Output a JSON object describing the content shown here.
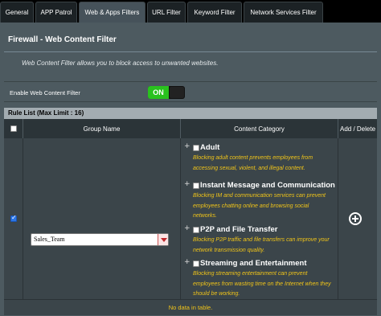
{
  "tabs": [
    {
      "label": "General",
      "active": false
    },
    {
      "label": "APP Patrol",
      "active": false
    },
    {
      "label": "Web & Apps Filters",
      "active": true
    },
    {
      "label": "URL Filter",
      "active": false
    },
    {
      "label": "Keyword Filter",
      "active": false
    },
    {
      "label": "Network Services Filter",
      "active": false
    }
  ],
  "page": {
    "title": "Firewall - Web Content Filter",
    "description": "Web Content Filter allows you to block access to unwanted websites."
  },
  "enable": {
    "label": "Enable Web Content Filter",
    "state": "ON"
  },
  "rule_list": {
    "title": "Rule List (Max Limit : 16)",
    "headers": {
      "group_name": "Group Name",
      "content_category": "Content Category",
      "add_delete": "Add / Delete"
    },
    "row_checked": true,
    "group_select_value": "Sales_Team",
    "categories": [
      {
        "expand": "+",
        "title": "Adult",
        "checked": false,
        "description": "Blocking adult content prevents employees from accessing sexual, violent, and illegal content."
      },
      {
        "expand": "+",
        "title": "Instant Message and Communication",
        "checked": false,
        "description": "Blocking IM and communication services can prevent employees chatting online and browsing social networks."
      },
      {
        "expand": "+",
        "title": "P2P and File Transfer",
        "checked": false,
        "description": "Blocking P2P traffic and file transfers can improve your network transmission quality."
      },
      {
        "expand": "+",
        "title": "Streaming and Entertainment",
        "checked": false,
        "description": "Blocking streaming entertainment can prevent employees from wasting time on the Internet when they should be working."
      }
    ],
    "empty_message": "No data in table."
  },
  "colors": {
    "toggle_on": "#29c21e",
    "description_text": "#f0c419",
    "rule_header_bg": "#a3acb1"
  }
}
